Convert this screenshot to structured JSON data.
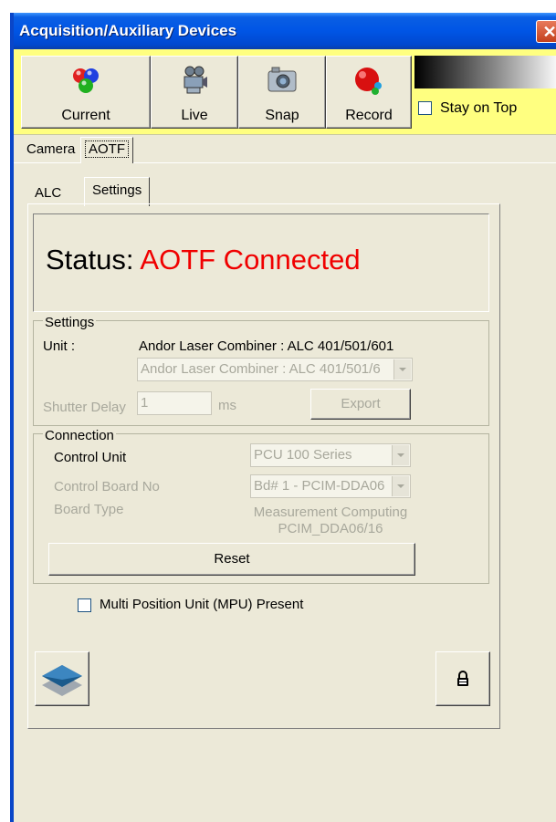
{
  "window": {
    "title": "Acquisition/Auxiliary Devices",
    "close_glyph": "✕"
  },
  "toolbar": {
    "buttons": [
      {
        "label": "Current",
        "icon": "rgb-spheres-icon"
      },
      {
        "label": "Live",
        "icon": "video-camera-icon"
      },
      {
        "label": "Snap",
        "icon": "photo-camera-icon"
      },
      {
        "label": "Record",
        "icon": "record-sphere-icon"
      }
    ],
    "stay_on_top": {
      "label": "Stay on Top",
      "checked": false
    }
  },
  "device_tabs": [
    "Camera",
    "AOTF"
  ],
  "device_tab_active": "AOTF",
  "aotf_tabs": [
    "ALC",
    "Settings"
  ],
  "aotf_tab_active": "Settings",
  "status": {
    "label": "Status:",
    "value": "AOTF Connected",
    "value_color": "#f00000"
  },
  "settings": {
    "legend": "Settings",
    "unit_label": "Unit :",
    "unit_value": "Andor Laser Combiner : ALC 401/501/601",
    "unit_combo": "Andor Laser Combiner : ALC 401/501/6",
    "shutter_label": "Shutter Delay",
    "shutter_value": "1",
    "shutter_unit": "ms",
    "export_label": "Export"
  },
  "connection": {
    "legend": "Connection",
    "control_unit_label": "Control Unit",
    "control_unit_value": "PCU 100 Series",
    "board_no_label": "Control Board No",
    "board_no_value": "Bd# 1 - PCIM-DDA06",
    "board_type_label": "Board Type",
    "board_type_line1": "Measurement Computing",
    "board_type_line2": "PCIM_DDA06/16",
    "reset_label": "Reset"
  },
  "mpu": {
    "label": "Multi Position Unit (MPU) Present",
    "checked": false
  },
  "bottom_buttons": [
    {
      "icon": "layers-icon"
    },
    {
      "icon": "lock-icon"
    }
  ]
}
